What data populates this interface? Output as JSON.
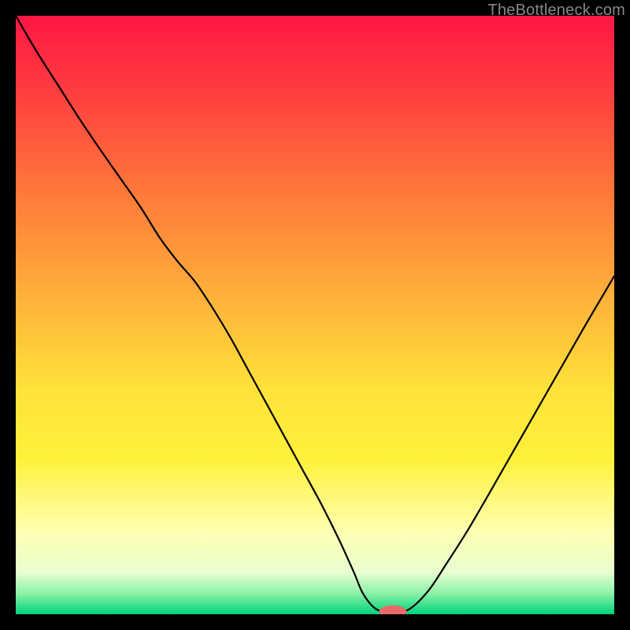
{
  "watermark": "TheBottleneck.com",
  "chart_data": {
    "type": "line",
    "title": "",
    "xlabel": "",
    "ylabel": "",
    "xlim": [
      0,
      100
    ],
    "ylim": [
      0,
      100
    ],
    "grid": false,
    "legend": false,
    "gradient_stops": [
      {
        "pos": 0.0,
        "color": "#ff1744"
      },
      {
        "pos": 0.12,
        "color": "#ff3b3f"
      },
      {
        "pos": 0.3,
        "color": "#ff7a3a"
      },
      {
        "pos": 0.48,
        "color": "#ffb43a"
      },
      {
        "pos": 0.62,
        "color": "#ffe13a"
      },
      {
        "pos": 0.74,
        "color": "#fff13a"
      },
      {
        "pos": 0.86,
        "color": "#ffffb0"
      },
      {
        "pos": 0.93,
        "color": "#e8ffd0"
      },
      {
        "pos": 0.965,
        "color": "#8cf2a8"
      },
      {
        "pos": 1.0,
        "color": "#00d27a"
      }
    ],
    "series": [
      {
        "name": "bottleneck-curve",
        "stroke": "#000000",
        "stroke_width": 2.2,
        "x": [
          0.0,
          3.5,
          7.0,
          10.5,
          14.0,
          17.5,
          21.0,
          24.0,
          27.0,
          30.0,
          33.0,
          36.0,
          39.0,
          42.0,
          45.0,
          48.0,
          51.0,
          54.0,
          56.5,
          58.0,
          60.0,
          62.0,
          64.0,
          66.0,
          69.0,
          72.0,
          75.5,
          79.0,
          83.0,
          87.0,
          91.0,
          95.0,
          100.0
        ],
        "y": [
          100.0,
          94.0,
          88.5,
          83.0,
          77.8,
          72.8,
          67.8,
          63.0,
          59.0,
          55.5,
          51.0,
          46.0,
          40.5,
          35.0,
          29.5,
          24.0,
          18.5,
          12.5,
          7.0,
          3.5,
          1.0,
          0.4,
          0.4,
          1.0,
          4.0,
          8.5,
          14.0,
          20.0,
          27.0,
          34.0,
          41.0,
          48.0,
          56.5
        ]
      }
    ],
    "marker": {
      "name": "optimal-point",
      "x": 63.0,
      "y": 0.4,
      "rx": 2.3,
      "ry": 1.1,
      "fill": "#e86a6a"
    }
  }
}
